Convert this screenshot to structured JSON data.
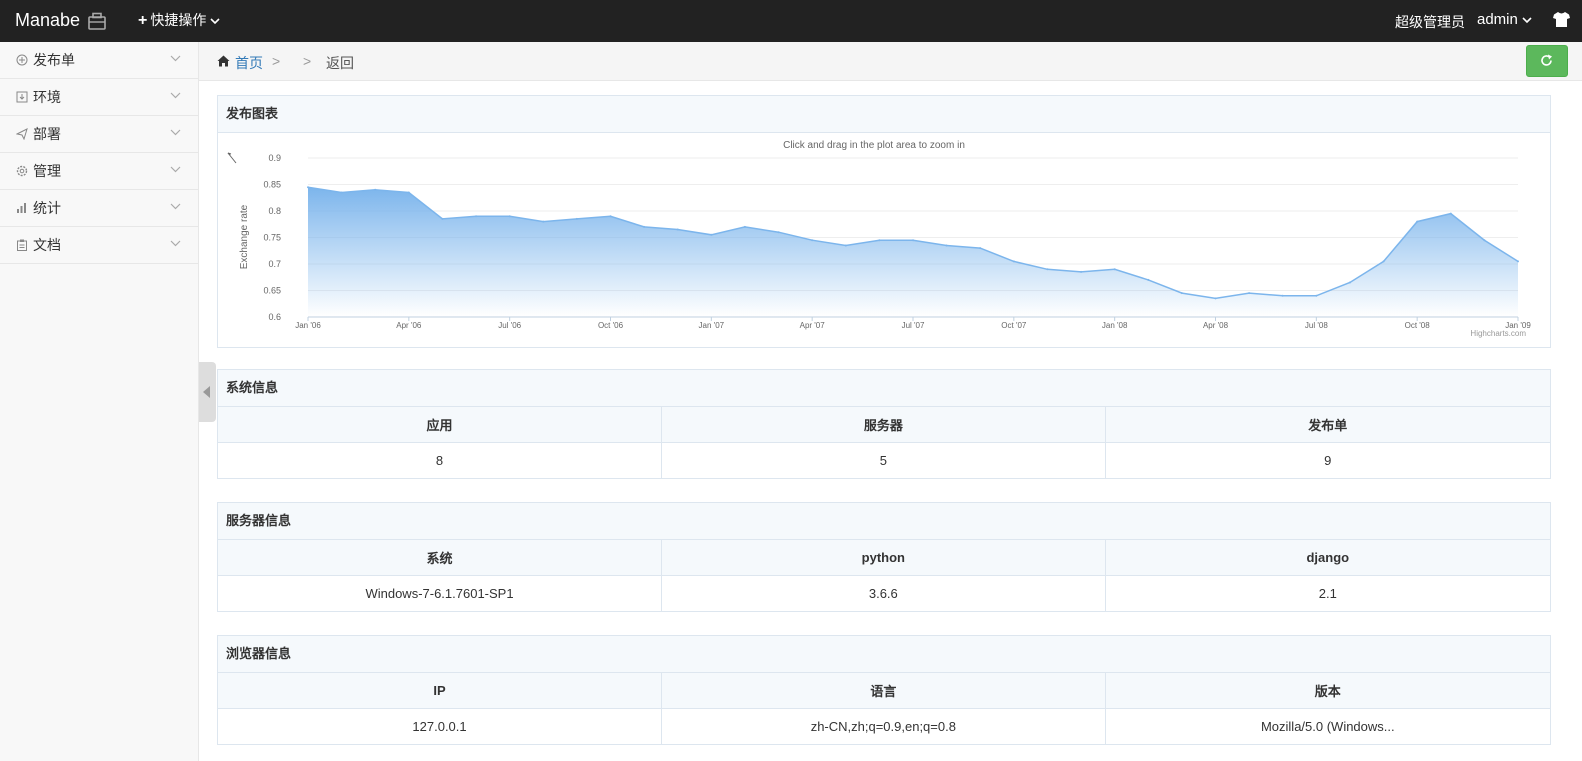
{
  "topbar": {
    "brand": "Manabe",
    "quick_actions": "快捷操作",
    "role": "超级管理员",
    "user": "admin"
  },
  "sidebar": {
    "items": [
      {
        "label": "发布单",
        "icon": "plus-circle-icon"
      },
      {
        "label": "环境",
        "icon": "import-icon"
      },
      {
        "label": "部署",
        "icon": "send-icon"
      },
      {
        "label": "管理",
        "icon": "gear-icon"
      },
      {
        "label": "统计",
        "icon": "bar-chart-icon"
      },
      {
        "label": "文档",
        "icon": "clipboard-icon"
      }
    ]
  },
  "breadcrumb": {
    "home": "首页",
    "sep": ">",
    "back": "返回"
  },
  "chart_panel": {
    "title": "发布图表"
  },
  "chart_data": {
    "type": "area",
    "subtitle": "Click and drag in the plot area to zoom in",
    "ylabel": "Exchange rate",
    "ylim": [
      0.6,
      0.9
    ],
    "yticks": [
      "0.9",
      "0.85",
      "0.8",
      "0.75",
      "0.7",
      "0.65",
      "0.6"
    ],
    "xticks": [
      "Jan '06",
      "Apr '06",
      "Jul '06",
      "Oct '06",
      "Jan '07",
      "Apr '07",
      "Jul '07",
      "Oct '07",
      "Jan '08",
      "Apr '08",
      "Jul '08",
      "Oct '08",
      "Jan '09"
    ],
    "credits": "Highcharts.com",
    "series": [
      {
        "x": [
          "2006-01",
          "2006-02",
          "2006-03",
          "2006-04",
          "2006-05",
          "2006-06",
          "2006-07",
          "2006-08",
          "2006-09",
          "2006-10",
          "2006-11",
          "2006-12",
          "2007-01",
          "2007-02",
          "2007-03",
          "2007-04",
          "2007-05",
          "2007-06",
          "2007-07",
          "2007-08",
          "2007-09",
          "2007-10",
          "2007-11",
          "2007-12",
          "2008-01",
          "2008-02",
          "2008-03",
          "2008-04",
          "2008-05",
          "2008-06",
          "2008-07",
          "2008-08",
          "2008-09",
          "2008-10",
          "2008-11",
          "2008-12",
          "2009-01"
        ],
        "values": [
          0.845,
          0.835,
          0.84,
          0.835,
          0.785,
          0.79,
          0.79,
          0.78,
          0.785,
          0.79,
          0.77,
          0.765,
          0.755,
          0.77,
          0.76,
          0.745,
          0.735,
          0.745,
          0.745,
          0.735,
          0.73,
          0.705,
          0.69,
          0.685,
          0.69,
          0.67,
          0.645,
          0.635,
          0.645,
          0.64,
          0.64,
          0.665,
          0.705,
          0.78,
          0.795,
          0.745,
          0.705
        ]
      }
    ]
  },
  "system_panel": {
    "title": "系统信息",
    "headers": [
      "应用",
      "服务器",
      "发布单"
    ],
    "values": [
      "8",
      "5",
      "9"
    ]
  },
  "server_panel": {
    "title": "服务器信息",
    "headers": [
      "系统",
      "python",
      "django"
    ],
    "values": [
      "Windows-7-6.1.7601-SP1",
      "3.6.6",
      "2.1"
    ]
  },
  "browser_panel": {
    "title": "浏览器信息",
    "headers": [
      "IP",
      "语言",
      "版本"
    ],
    "values": [
      "127.0.0.1",
      "zh-CN,zh;q=0.9,en;q=0.8",
      "Mozilla/5.0 (Windows..."
    ]
  }
}
